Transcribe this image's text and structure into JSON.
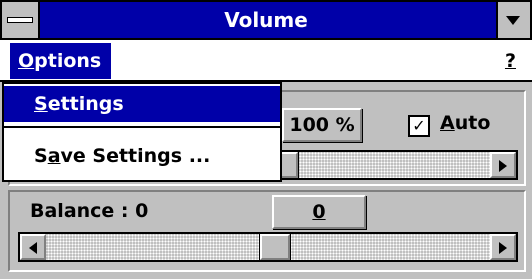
{
  "window": {
    "title": "Volume"
  },
  "menubar": {
    "options_pre": "",
    "options_u": "O",
    "options_post": "ptions",
    "help": "?"
  },
  "dropdown": {
    "settings_u": "S",
    "settings_rest": "ettings",
    "save_pre": "S",
    "save_u": "a",
    "save_rest": "ve Settings ..."
  },
  "volume": {
    "value_label": "100 %"
  },
  "auto": {
    "check": "✓",
    "label_u": "A",
    "label_rest": "uto"
  },
  "balance": {
    "label": "Balance : 0",
    "button": "0"
  },
  "icons": {
    "right_arrow": "right-arrow-icon",
    "left_arrow": "left-arrow-icon"
  }
}
